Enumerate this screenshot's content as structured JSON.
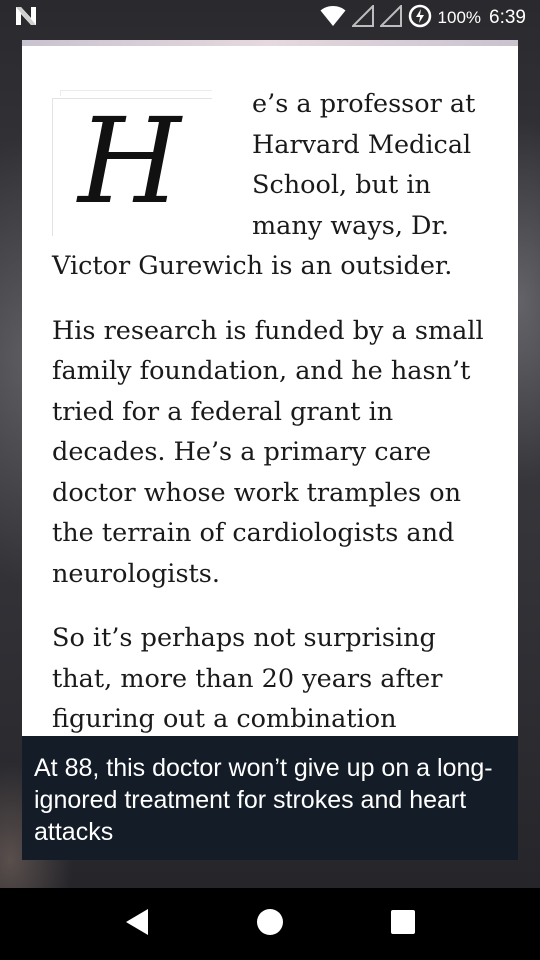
{
  "status_bar": {
    "battery_percent": "100%",
    "time": "6:39"
  },
  "article": {
    "drop_cap": "H",
    "first_paragraph_rest": "e’s a professor at Harvard Medical School, but in many ways, Dr. Victor Gurewich is an outsider.",
    "paragraph_2": "His research is funded by a small family foundation, and he hasn’t tried for a federal grant in decades. He’s a primary care doctor whose work tramples on the terrain of cardiologists and neurologists.",
    "paragraph_3": "So it’s perhaps not surprising that, more than 20 years after figuring out a combination therapy that he"
  },
  "caption": {
    "title": "At 88, this doctor won’t give up on a long-ignored treatment for strokes and heart attacks"
  },
  "icons": {
    "notification": "n-logo-icon",
    "wifi": "wifi-icon",
    "signal_1": "signal-icon",
    "signal_2": "signal-icon",
    "battery_saver": "battery-saver-icon",
    "back": "back-icon",
    "home": "home-icon",
    "recents": "recents-icon"
  }
}
